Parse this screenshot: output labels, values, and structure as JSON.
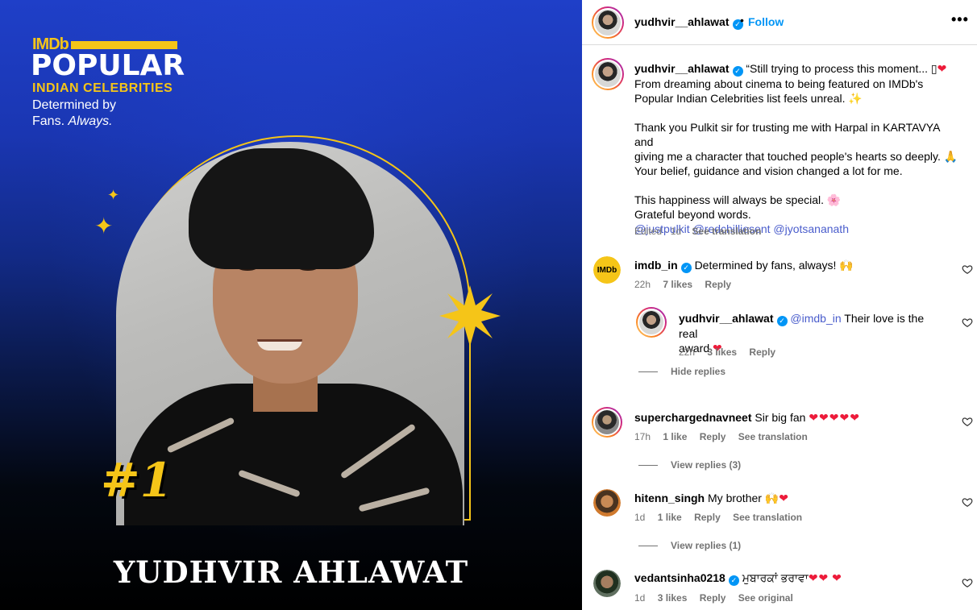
{
  "poster": {
    "brand": "IMDb",
    "title": "POPULAR",
    "subtitle": "INDIAN CELEBRITIES",
    "tagline_1": "Determined by",
    "tagline_2a": "Fans.",
    "tagline_2b": "Always.",
    "rank": "#1",
    "celebrity_name": "YUDHVIR AHLAWAT"
  },
  "header": {
    "username": "yudhvir__ahlawat",
    "verified": true,
    "separator": "•",
    "follow_label": "Follow",
    "more_label": "•••"
  },
  "caption": {
    "username": "yudhvir__ahlawat",
    "line1": "“Still trying to process this moment... ▯",
    "line1_heart": "❤",
    "line2": "From dreaming about cinema to being featured on IMDb's",
    "line3": "Popular Indian Celebrities list feels unreal. ✨",
    "line4": "Thank you Pulkit sir for trusting me with Harpal in KARTAVYA and",
    "line5": "giving me a character that touched people's hearts so deeply. 🙏",
    "line6": "Your belief, guidance and vision changed a lot for me.",
    "line7": "This happiness will always be special. 🌸",
    "line8": "Grateful beyond words.",
    "mentions": "@justpulkit @redchilliesent @jyotsananath",
    "edited": "Edited · 1d",
    "see_translation": "See translation"
  },
  "comments": [
    {
      "username": "imdb_in",
      "verified": true,
      "text": "Determined by fans, always! 🙌",
      "time": "22h",
      "likes": "7 likes",
      "reply": "Reply",
      "avatar_label": "IMDb",
      "replies": [
        {
          "username": "yudhvir__ahlawat",
          "verified": true,
          "mention": "@imdb_in",
          "text_a": "Their love is the real",
          "text_b": "award",
          "heart": "❤",
          "time": "22h",
          "likes": "3 likes",
          "reply": "Reply"
        }
      ],
      "toggle": "Hide replies"
    },
    {
      "username": "superchargednavneet",
      "verified": false,
      "text": "Sir big fan",
      "hearts": "❤❤❤❤❤",
      "time": "17h",
      "likes": "1 like",
      "reply": "Reply",
      "see_translation": "See translation",
      "toggle": "View replies (3)"
    },
    {
      "username": "hitenn_singh",
      "verified": false,
      "text": "My brother 🙌",
      "hearts": "❤",
      "time": "1d",
      "likes": "1 like",
      "reply": "Reply",
      "see_translation": "See translation",
      "toggle": "View replies (1)"
    },
    {
      "username": "vedantsinha0218",
      "verified": true,
      "text": "ਮੁਬਾਰਕਾਂ ਭਰਾਵਾ",
      "hearts": "❤❤",
      "heart_last": "❤",
      "time": "1d",
      "likes": "3 likes",
      "reply": "Reply",
      "see_original": "See original"
    }
  ],
  "colors": {
    "imdb_yellow": "#f5c518",
    "link_blue": "#0095f6",
    "mention_blue": "#4a5dcc",
    "heart_red": "#ed1b3a",
    "meta_gray": "#737373"
  },
  "icons": [
    "verified-badge-icon",
    "more-options-icon",
    "heart-outline-icon",
    "sparkle-icon",
    "star-burst-icon"
  ]
}
